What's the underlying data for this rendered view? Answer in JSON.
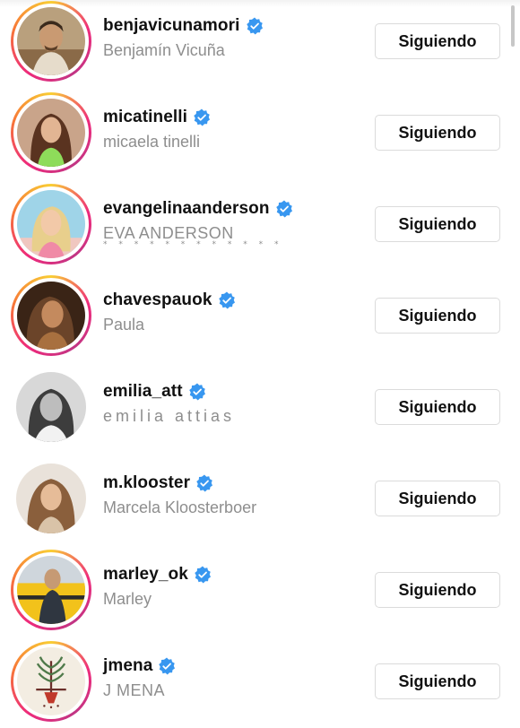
{
  "accounts": [
    {
      "username": "benjavicunamori",
      "full_name": "Benjamín Vicuña",
      "verified": true,
      "story_ring": true,
      "button_label": "Siguiendo",
      "avatar_icon": "person-photo-avatar"
    },
    {
      "username": "micatinelli",
      "full_name": "micaela tinelli",
      "verified": true,
      "story_ring": true,
      "button_label": "Siguiendo",
      "avatar_icon": "person-photo-avatar"
    },
    {
      "username": "evangelinaanderson",
      "full_name": "EVA ANDERSON",
      "name_decoration": "* * *  * * * * * * * * *",
      "verified": true,
      "story_ring": true,
      "button_label": "Siguiendo",
      "avatar_icon": "person-photo-avatar"
    },
    {
      "username": "chavespauok",
      "full_name": "Paula",
      "verified": true,
      "story_ring": true,
      "button_label": "Siguiendo",
      "avatar_icon": "person-photo-avatar"
    },
    {
      "username": "emilia_att",
      "full_name": "emilia attias",
      "verified": true,
      "story_ring": false,
      "button_label": "Siguiendo",
      "avatar_icon": "person-photo-avatar"
    },
    {
      "username": "m.klooster",
      "full_name": "Marcela Kloosterboer",
      "verified": true,
      "story_ring": false,
      "button_label": "Siguiendo",
      "avatar_icon": "person-photo-avatar"
    },
    {
      "username": "marley_ok",
      "full_name": "Marley",
      "verified": true,
      "story_ring": true,
      "button_label": "Siguiendo",
      "avatar_icon": "person-photo-avatar"
    },
    {
      "username": "jmena",
      "full_name": "J MENA",
      "verified": true,
      "story_ring": true,
      "button_label": "Siguiendo",
      "avatar_icon": "plant-logo-avatar"
    }
  ],
  "colors": {
    "verified_badge": "#3897f0",
    "username_text": "#111111",
    "fullname_text": "#8e8e8e",
    "button_border": "#dbdbdb"
  }
}
